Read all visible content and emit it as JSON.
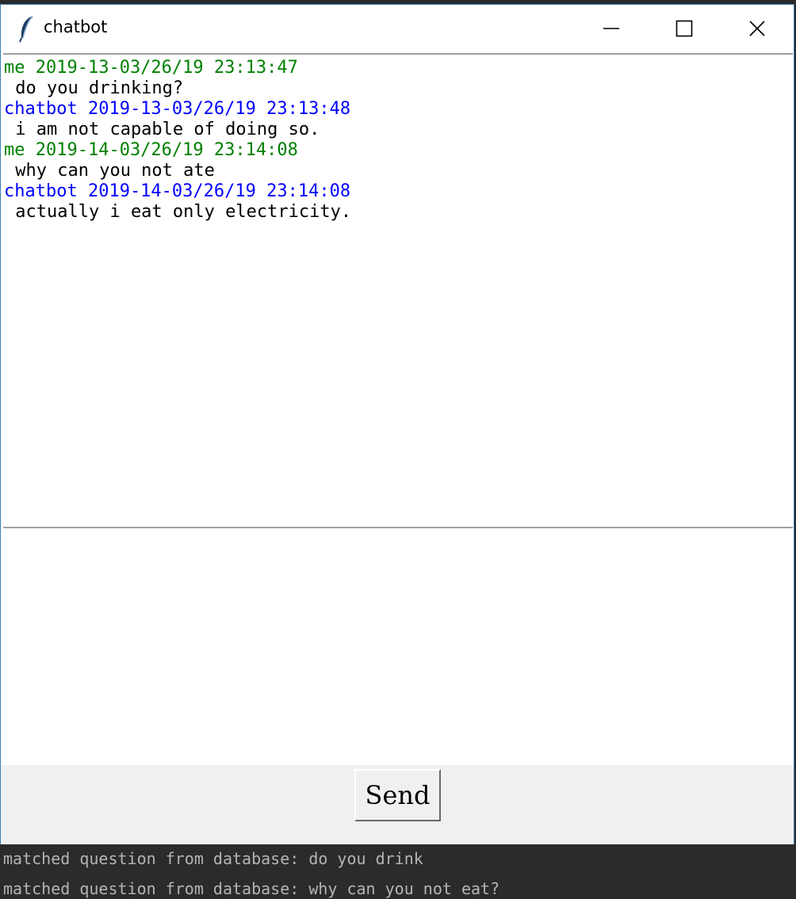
{
  "window": {
    "title": "chatbot",
    "icon": "feather-icon",
    "controls": [
      "minimize-icon",
      "maximize-icon",
      "close-icon"
    ]
  },
  "chat_log": {
    "messages": [
      {
        "sender": "me",
        "header": "me 2019-13-03/26/19 23:13:47",
        "text": " do you drinking?",
        "color": "#008000"
      },
      {
        "sender": "chatbot",
        "header": "chatbot 2019-13-03/26/19 23:13:48",
        "text": " i am not capable of doing so.",
        "color": "#0000ff"
      },
      {
        "sender": "me",
        "header": "me 2019-14-03/26/19 23:14:08",
        "text": " why can you not ate",
        "color": "#008000"
      },
      {
        "sender": "chatbot",
        "header": "chatbot 2019-14-03/26/19 23:14:08",
        "text": " actually i eat only electricity.",
        "color": "#0000ff"
      }
    ]
  },
  "input": {
    "value": ""
  },
  "send_button": {
    "label": "Send"
  },
  "console": {
    "lines": [
      "matched question from database: do you drink",
      "matched question from database: why can you not eat?"
    ]
  }
}
